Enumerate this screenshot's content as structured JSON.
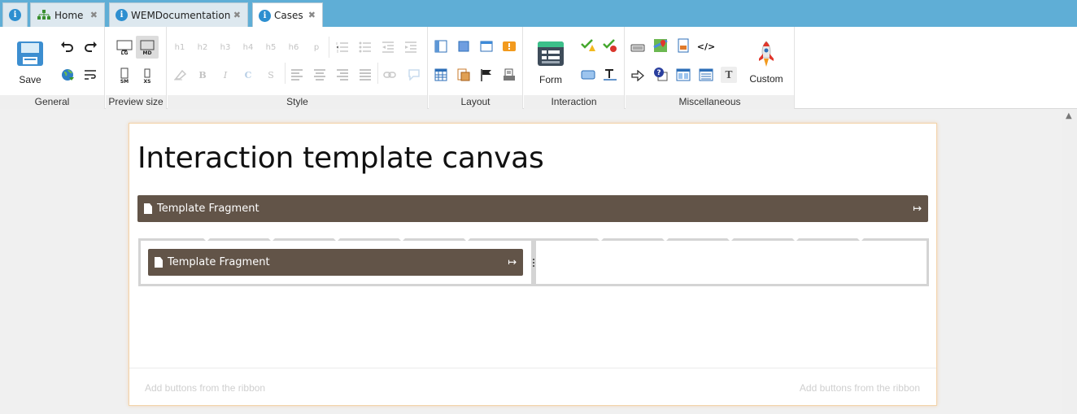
{
  "tabs": [
    {
      "label": "",
      "icon": "info-icon",
      "closable": false
    },
    {
      "label": "Home",
      "icon": "sitemap-icon",
      "closable": true
    },
    {
      "label": "WEMDocumentation",
      "icon": "info-icon",
      "closable": true
    },
    {
      "label": "Cases",
      "icon": "info-icon",
      "closable": true,
      "active": true
    }
  ],
  "ribbon": {
    "general": {
      "label": "General",
      "save_label": "Save"
    },
    "preview_size": {
      "label": "Preview size",
      "sizes": [
        "LG",
        "MD",
        "SM",
        "XS"
      ],
      "active": "MD"
    },
    "style": {
      "label": "Style",
      "headings": [
        "h1",
        "h2",
        "h3",
        "h4",
        "h5",
        "h6",
        "p"
      ],
      "format": [
        "B",
        "I",
        "C",
        "S"
      ]
    },
    "layout": {
      "label": "Layout"
    },
    "interaction": {
      "label": "Interaction",
      "form_label": "Form"
    },
    "miscellaneous": {
      "label": "Miscellaneous",
      "custom_label": "Custom",
      "text_glyph": "T"
    }
  },
  "canvas": {
    "title": "Interaction template canvas",
    "fragment_label": "Template Fragment",
    "inner_fragment_label": "Template Fragment",
    "footer_left": "Add buttons from the ribbon",
    "footer_right": "Add buttons from the ribbon"
  },
  "colors": {
    "tabbar": "#5faed6",
    "fragment": "#625448",
    "canvas_border": "#f3d3aa"
  }
}
